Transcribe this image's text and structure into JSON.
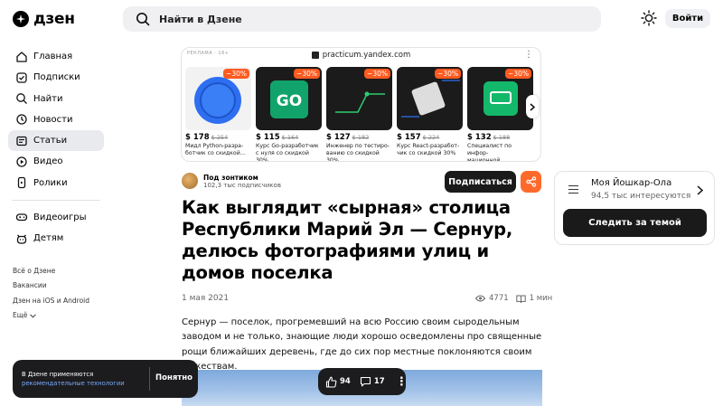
{
  "header": {
    "logo_text": "дзен",
    "search_placeholder": "Найти в Дзене",
    "login_label": "Войти"
  },
  "sidebar": {
    "items": [
      {
        "label": "Главная",
        "icon": "home-icon"
      },
      {
        "label": "Подписки",
        "icon": "subscriptions-icon"
      },
      {
        "label": "Найти",
        "icon": "search-icon"
      },
      {
        "label": "Новости",
        "icon": "news-icon"
      },
      {
        "label": "Статьи",
        "icon": "articles-icon",
        "active": true
      },
      {
        "label": "Видео",
        "icon": "video-icon"
      },
      {
        "label": "Ролики",
        "icon": "shorts-icon"
      },
      {
        "label": "Видеоигры",
        "icon": "gamepad-icon"
      },
      {
        "label": "Детям",
        "icon": "kids-icon"
      }
    ],
    "footer": [
      "Всё о Дзене",
      "Вакансии",
      "Дзен на iOS и Android",
      "Ещё"
    ]
  },
  "ad": {
    "label": "РЕКЛАМА · 16+",
    "host": "practicum.yandex.com",
    "cards": [
      {
        "discount": "−30%",
        "price": "$ 178",
        "old_price": "$ 254",
        "desc": "Мидл Python-разра-\nботчик со скидкой…",
        "color": "#2e6ff2"
      },
      {
        "discount": "−30%",
        "price": "$ 115",
        "old_price": "$ 164",
        "desc": "Курс Go-разработчик\nс нуля со скидкой 30%",
        "color": "#12a36a"
      },
      {
        "discount": "−30%",
        "price": "$ 127",
        "old_price": "$ 182",
        "desc": "Инженер по тестиро-\nванию со скидкой 30%",
        "color": "#1b1b1b"
      },
      {
        "discount": "−30%",
        "price": "$ 157",
        "old_price": "$ 224",
        "desc": "Курс React-разработ-\nчик со скидкой 30%",
        "color": "#1b1b1b"
      },
      {
        "discount": "−30%",
        "price": "$ 132",
        "old_price": "$ 188",
        "desc": "Специалист по инфор-\nмационной безопасн…",
        "color": "#1b1b1b"
      }
    ]
  },
  "article": {
    "channel_name": "Под зонтиком",
    "channel_subs": "102,3 тыс подписчиков",
    "subscribe_label": "Подписаться",
    "title": "Как выглядит «сырная» столица Республики Марий Эл — Сернур, делюсь фотографиями улиц и домов поселка",
    "date": "1 мая 2021",
    "views": "4771",
    "read_time": "1 мин",
    "lead": "Сернур — поселок, прогремевший на всю Россию своим сыродельным заводом и не только, знающие люди хорошо осведомлены про священные рощи ближайших деревень, где до сих пор местные поклоняются своим божествам."
  },
  "topic": {
    "name": "Моя Йошкар-Ола",
    "count": "94,5 тыс интересуются",
    "follow_label": "Следить за темой"
  },
  "cookie": {
    "text": "В Дзене применяются",
    "link": "рекомендательные технологии",
    "ok_label": "Понятно"
  },
  "reactions": {
    "likes": "94",
    "comments": "17"
  },
  "colors": {
    "accent": "#ff6a2b",
    "dark_button": "#1a1a1a",
    "sidebar_active": "#e9eaee"
  }
}
